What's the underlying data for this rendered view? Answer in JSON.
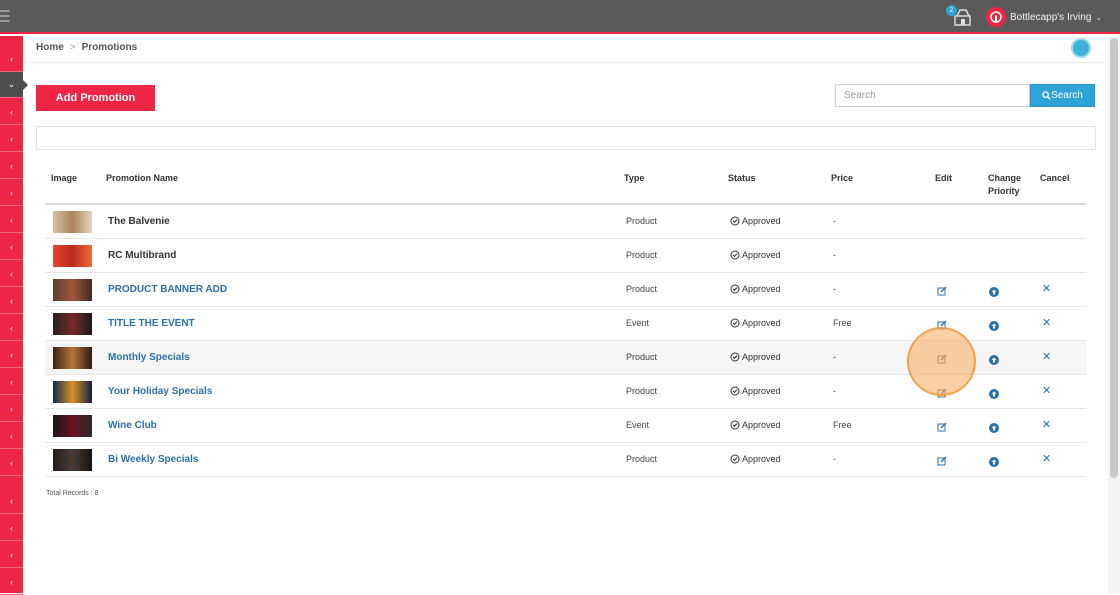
{
  "header": {
    "notification_count": "2",
    "store_name": "Bottlecapp's Irving"
  },
  "breadcrumb": {
    "home": "Home",
    "separator": ">",
    "current": "Promotions"
  },
  "toolbar": {
    "add_label": "Add Promotion",
    "search_placeholder": "Search",
    "search_label": "Search"
  },
  "table": {
    "headers": {
      "image": "Image",
      "name": "Promotion Name",
      "type": "Type",
      "status": "Status",
      "price": "Price",
      "edit": "Edit",
      "change_priority_1": "Change",
      "change_priority_2": "Priority",
      "cancel": "Cancel"
    },
    "rows": [
      {
        "name": "The Balvenie",
        "type": "Product",
        "status": "Approved",
        "price": "-",
        "actions": false
      },
      {
        "name": "RC Multibrand",
        "type": "Product",
        "status": "Approved",
        "price": "-",
        "actions": false
      },
      {
        "name": "PRODUCT BANNER ADD",
        "type": "Product",
        "status": "Approved",
        "price": "-",
        "actions": true
      },
      {
        "name": "TITLE THE EVENT",
        "type": "Event",
        "status": "Approved",
        "price": "Free",
        "actions": true
      },
      {
        "name": "Monthly Specials",
        "type": "Product",
        "status": "Approved",
        "price": "-",
        "actions": true
      },
      {
        "name": "Your Holiday Specials",
        "type": "Product",
        "status": "Approved",
        "price": "-",
        "actions": true
      },
      {
        "name": "Wine Club",
        "type": "Event",
        "status": "Approved",
        "price": "Free",
        "actions": true
      },
      {
        "name": "Bi Weekly Specials",
        "type": "Product",
        "status": "Approved",
        "price": "-",
        "actions": true
      }
    ]
  },
  "footer": {
    "total_records": "Total Records : 8"
  },
  "colors": {
    "accent": "#ee2544",
    "link": "#2d6fa8",
    "search_button": "#2ea3d8"
  }
}
